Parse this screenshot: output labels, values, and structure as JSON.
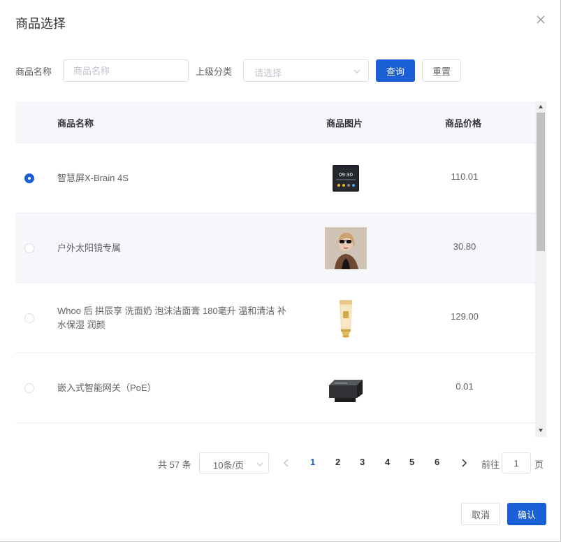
{
  "dialog": {
    "title": "商品选择"
  },
  "filters": {
    "name_label": "商品名称",
    "name_placeholder": "商品名称",
    "category_label": "上级分类",
    "category_placeholder": "请选择",
    "query_label": "查询",
    "reset_label": "重置"
  },
  "table": {
    "headers": {
      "name": "商品名称",
      "image": "商品图片",
      "price": "商品价格"
    },
    "rows": [
      {
        "name": "智慧屏X-Brain 4S",
        "price": "110.01",
        "selected": true,
        "image": "smart-screen-image"
      },
      {
        "name": "户外太阳镜专属",
        "price": "30.80",
        "selected": false,
        "image": "sunglasses-model-image"
      },
      {
        "name": "Whoo 后 拱辰享 洗面奶 泡沫洁面膏 180毫升 温和清洁 补水保湿 润颜",
        "price": "129.00",
        "selected": false,
        "image": "cleanser-tube-image"
      },
      {
        "name": "嵌入式智能网关（PoE）",
        "price": "0.01",
        "selected": false,
        "image": "gateway-device-image"
      }
    ]
  },
  "pagination": {
    "total": "共 57 条",
    "page_size": "10条/页",
    "pages": [
      "1",
      "2",
      "3",
      "4",
      "5",
      "6"
    ],
    "current": "1",
    "goto_prefix": "前往",
    "goto_value": "1",
    "goto_suffix": "页"
  },
  "footer": {
    "cancel_label": "取消",
    "confirm_label": "确认"
  },
  "colors": {
    "primary": "#1a5fd6",
    "header_bg": "#f5f7fa",
    "border": "#dcdfe6"
  }
}
